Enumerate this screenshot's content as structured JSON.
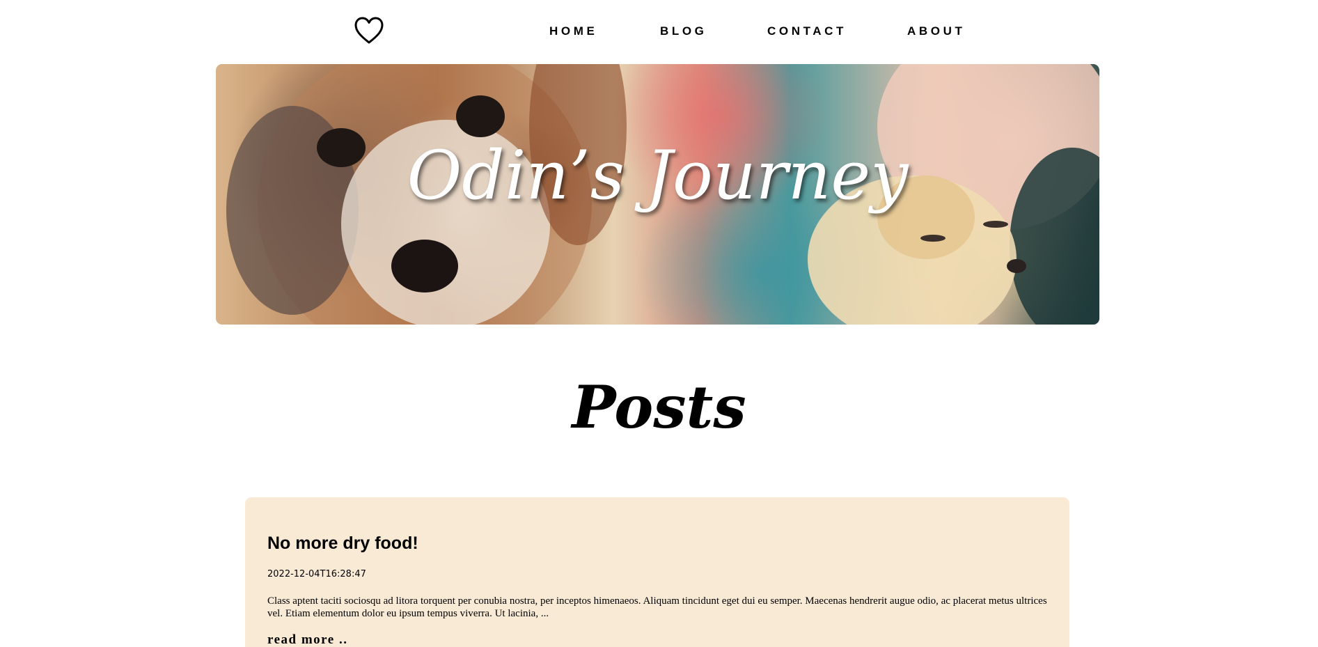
{
  "nav": {
    "logo_icon": "heart-outline-icon",
    "items": [
      {
        "label": "HOME"
      },
      {
        "label": "BLOG"
      },
      {
        "label": "CONTACT"
      },
      {
        "label": "ABOUT"
      }
    ]
  },
  "hero": {
    "title": "Odin’s Journey",
    "image_description_icon": "puppies-and-girl-painted-banner"
  },
  "main": {
    "heading": "Posts",
    "posts": [
      {
        "title": "No more dry food!",
        "date": "2022-12-04T16:28:47",
        "excerpt": "Class aptent taciti sociosqu ad litora torquent per conubia nostra, per inceptos himenaeos. Aliquam tincidunt eget dui eu semper. Maecenas hendrerit augue odio, ac placerat metus ultrices vel. Etiam elementum dolor eu ipsum tempus viverra. Ut lacinia, ...",
        "read_more": "read more .."
      }
    ]
  },
  "colors": {
    "card_background": "#f9ead6",
    "text": "#000000",
    "page_background": "#ffffff"
  }
}
